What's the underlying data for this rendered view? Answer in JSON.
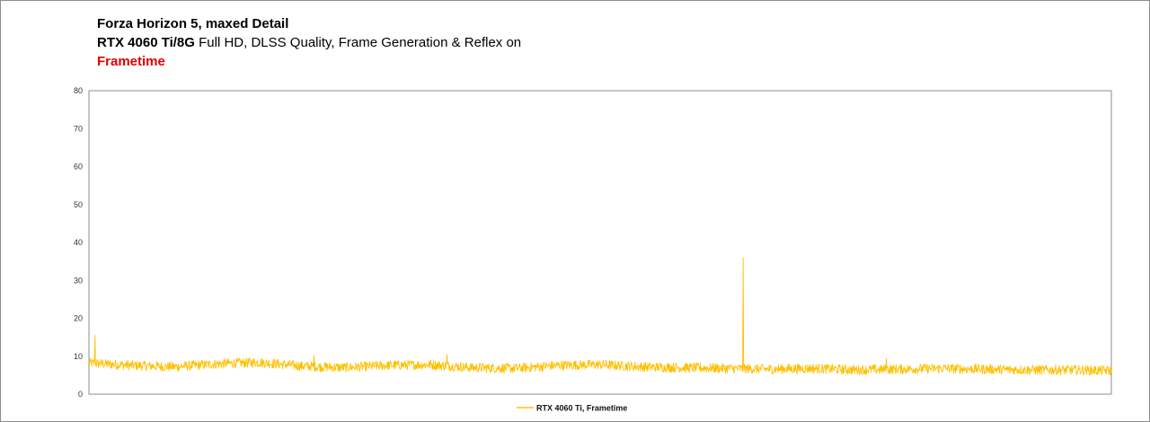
{
  "titles": {
    "line1": "Forza Horizon 5, maxed Detail",
    "line2_bold": "RTX 4060 Ti/8G",
    "line2_rest": " Full HD, DLSS Quality, Frame Generation & Reflex on",
    "line3": "Frametime"
  },
  "chart_data": {
    "type": "line",
    "title": "Forza Horizon 5, maxed Detail",
    "subtitle": "RTX 4060 Ti/8G Full HD, DLSS Quality, Frame Generation & Reflex on",
    "metric": "Frametime",
    "xlabel": "",
    "ylabel": "",
    "ylim": [
      0,
      80
    ],
    "yticks": [
      "0",
      "10",
      "20",
      "30",
      "40",
      "50",
      "60",
      "70",
      "80"
    ],
    "grid": false,
    "legend_placement": "bottom-center",
    "series": [
      {
        "name": "RTX 4060 Ti, Frametime",
        "color": "#ffc000",
        "baseline": [
          8.2,
          7.6,
          7.2,
          8.0,
          8.4,
          7.4,
          7.0,
          7.6,
          7.8,
          7.0,
          6.8,
          7.6,
          7.8,
          7.2,
          7.0,
          6.8,
          6.6,
          6.8,
          6.4,
          6.6,
          6.8,
          6.6,
          6.4,
          6.4,
          6.2
        ],
        "band": 1.3,
        "spikes": [
          {
            "at": 0.006,
            "value": 15.5
          },
          {
            "at": 0.22,
            "value": 10.2
          },
          {
            "at": 0.35,
            "value": 10.4
          },
          {
            "at": 0.64,
            "value": 36.0
          },
          {
            "at": 0.78,
            "value": 9.4
          }
        ]
      }
    ]
  }
}
